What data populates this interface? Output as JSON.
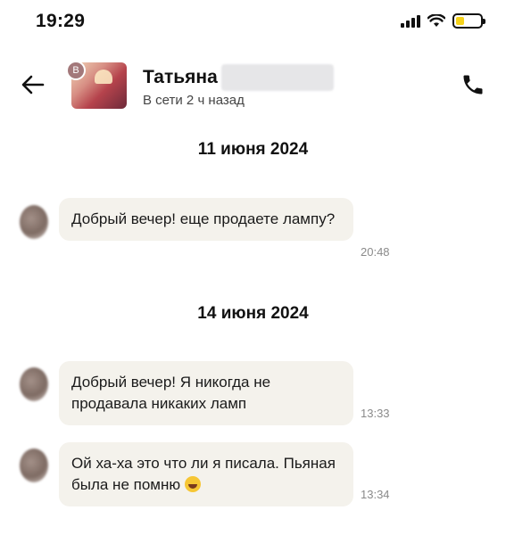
{
  "status_bar": {
    "time": "19:29",
    "icons": [
      "signal-icon",
      "wifi-icon",
      "battery-icon"
    ],
    "battery_level": 0.35,
    "battery_color": "#f5d21a"
  },
  "header": {
    "back_icon": "arrow-left-icon",
    "avatar_badge": "В",
    "contact_name": "Татьяна",
    "contact_status": "В сети 2 ч назад",
    "call_icon": "phone-icon"
  },
  "messages": [
    {
      "date": "11 июня 2024"
    },
    {
      "text": "Добрый вечер! еще продаете лампу?",
      "time": "20:48"
    },
    {
      "date": "14 июня 2024"
    },
    {
      "text": "Добрый вечер! Я никогда не продавала никаких ламп",
      "time": "13:33"
    },
    {
      "text": "Ой ха-ха это что ли я писала. Пьяная была не помню",
      "emoji": "laughing-emoji",
      "time": "13:34"
    }
  ],
  "colors": {
    "bubble_bg": "#f4f2ec",
    "time_text": "#8a8a8a",
    "avatar_badge_bg": "#a3787a"
  }
}
